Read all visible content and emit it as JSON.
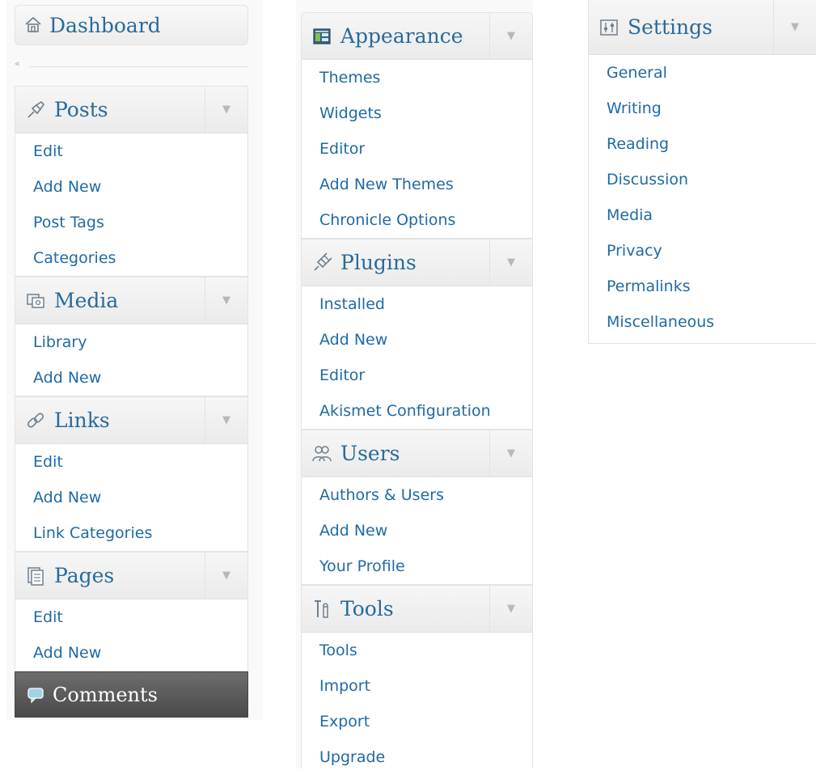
{
  "column1": {
    "dashboard": {
      "label": "Dashboard",
      "icon": "house-icon"
    },
    "collapse_arrow": "«",
    "posts": {
      "label": "Posts",
      "icon": "pushpin-icon",
      "items": [
        "Edit",
        "Add New",
        "Post Tags",
        "Categories"
      ]
    },
    "media": {
      "label": "Media",
      "icon": "media-icon",
      "items": [
        "Library",
        "Add New"
      ]
    },
    "links": {
      "label": "Links",
      "icon": "chain-link-icon",
      "items": [
        "Edit",
        "Add New",
        "Link Categories"
      ]
    },
    "pages": {
      "label": "Pages",
      "icon": "pages-icon",
      "items": [
        "Edit",
        "Add New"
      ]
    },
    "comments": {
      "label": "Comments",
      "icon": "speech-bubble-icon"
    }
  },
  "column2": {
    "appearance": {
      "label": "Appearance",
      "icon": "appearance-icon",
      "items": [
        "Themes",
        "Widgets",
        "Editor",
        "Add New Themes",
        "Chronicle Options"
      ]
    },
    "plugins": {
      "label": "Plugins",
      "icon": "plug-icon",
      "items": [
        "Installed",
        "Add New",
        "Editor",
        "Akismet Configuration"
      ]
    },
    "users": {
      "label": "Users",
      "icon": "users-icon",
      "items": [
        "Authors & Users",
        "Add New",
        "Your Profile"
      ]
    },
    "tools": {
      "label": "Tools",
      "icon": "tools-icon",
      "items": [
        "Tools",
        "Import",
        "Export",
        "Upgrade"
      ]
    }
  },
  "column3": {
    "settings": {
      "label": "Settings",
      "icon": "settings-icon",
      "items": [
        "General",
        "Writing",
        "Reading",
        "Discussion",
        "Media",
        "Privacy",
        "Permalinks",
        "Miscellaneous"
      ]
    }
  },
  "toggle_glyph": "▼",
  "colors": {
    "link": "#1f6aa5",
    "heading": "#2a6a9a",
    "toggle": "#b8b8b8",
    "comments_bg": "#5a5a5a"
  }
}
